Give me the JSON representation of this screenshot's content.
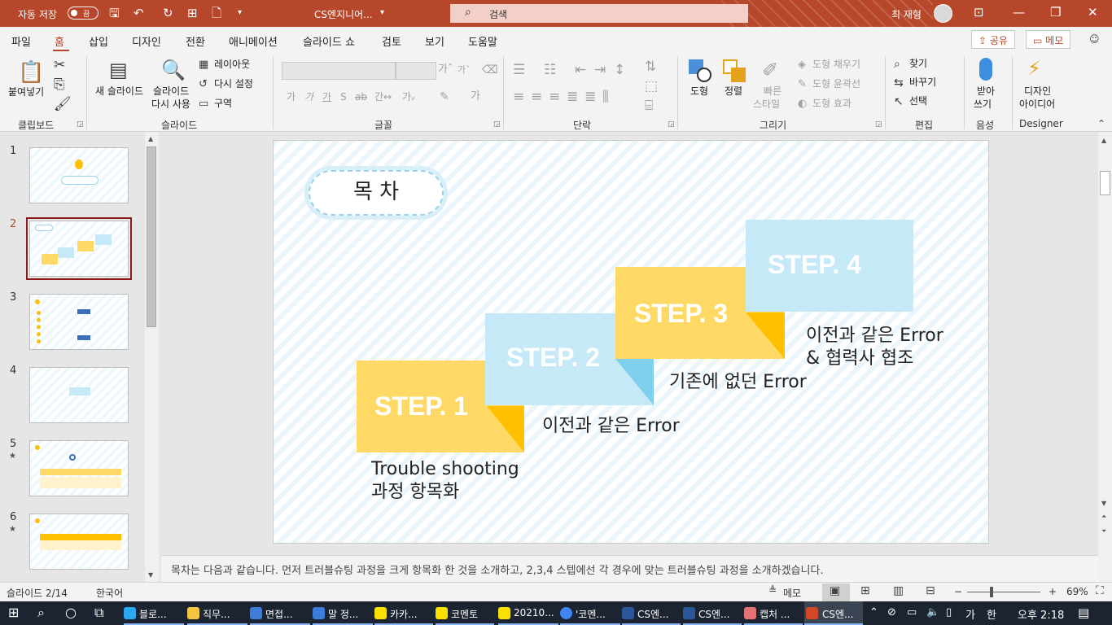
{
  "titlebar": {
    "autosave_label": "자동 저장",
    "autosave_state": "끔",
    "file_name": "CS엔지니어...",
    "search_placeholder": "검색",
    "user_name": "최 재형",
    "accent_color": "#b7472a"
  },
  "tabs": [
    "파일",
    "홈",
    "삽입",
    "디자인",
    "전환",
    "애니메이션",
    "슬라이드 쇼",
    "검토",
    "보기",
    "도움말"
  ],
  "active_tab": "홈",
  "share_label": "공유",
  "memo_label": "메모",
  "ribbon": {
    "clipboard": {
      "paste": "붙여넣기",
      "label": "클립보드"
    },
    "slides": {
      "new_slide": "새 슬라이드",
      "reuse_line1": "슬라이드",
      "reuse_line2": "다시 사용",
      "layout": "레이아웃",
      "reset": "다시 설정",
      "section": "구역",
      "label": "슬라이드"
    },
    "font": {
      "label": "글꼴"
    },
    "paragraph": {
      "label": "단락"
    },
    "drawing": {
      "shapes": "도형",
      "arrange": "정렬",
      "quick_styles_line1": "빠른",
      "quick_styles_line2": "스타일",
      "fill": "도형 채우기",
      "outline": "도형 윤곽선",
      "effects": "도형 효과",
      "label": "그리기"
    },
    "editing": {
      "find": "찾기",
      "replace": "바꾸기",
      "select": "선택",
      "label": "편집"
    },
    "voice": {
      "dictate_line1": "받아",
      "dictate_line2": "쓰기",
      "label": "음성"
    },
    "designer": {
      "ideas_line1": "디자인",
      "ideas_line2": "아이디어",
      "label": "Designer"
    }
  },
  "slides_panel": {
    "numbers": [
      "1",
      "2",
      "3",
      "4",
      "5",
      "6"
    ],
    "selected": "2"
  },
  "slide": {
    "title": "목 차",
    "steps": [
      {
        "heading": "STEP. 1",
        "label_line1": "Trouble shooting",
        "label_line2": "과정 항목화",
        "color": "#ffd966"
      },
      {
        "heading": "STEP. 2",
        "label_line1": "이전과 같은 Error",
        "label_line2": "",
        "color": "#c5e9f7"
      },
      {
        "heading": "STEP. 3",
        "label_line1": "기존에 없던 Error",
        "label_line2": "",
        "color": "#ffd966"
      },
      {
        "heading": "STEP. 4",
        "label_line1": "이전과 같은 Error",
        "label_line2": "& 협력사 협조",
        "color": "#c5e9f7"
      }
    ]
  },
  "notes_text": "목차는 다음과 같습니다. 먼저 트러블슈팅 과정을 크게 항목화 한 것을 소개하고, 2,3,4 스텝에선 각 경우에 맞는 트러블슈팅 과정을 소개하겠습니다.",
  "statusbar": {
    "slide_count": "슬라이드 2/14",
    "language": "한국어",
    "notes_btn": "메모",
    "zoom": "69%"
  },
  "taskbar": {
    "items": [
      {
        "label": "블로...",
        "color": "#2aa8f0"
      },
      {
        "label": "직무...",
        "color": "#f5c542"
      },
      {
        "label": "면접...",
        "color": "#3b7dd8"
      },
      {
        "label": "말 정...",
        "color": "#3b7dd8"
      },
      {
        "label": "카카...",
        "color": "#f9e000"
      },
      {
        "label": "코멘토",
        "color": "#f9e000"
      },
      {
        "label": "20210...",
        "color": "#f9e000"
      },
      {
        "label": "'코멘...",
        "color": "#4285f4"
      },
      {
        "label": "CS엔...",
        "color": "#2b579a"
      },
      {
        "label": "CS엔...",
        "color": "#2b579a"
      },
      {
        "label": "캡처 ...",
        "color": "#e57373"
      },
      {
        "label": "CS엔...",
        "color": "#d24726"
      }
    ],
    "ime": "가",
    "ime2": "한",
    "clock": "오후 2:18"
  }
}
